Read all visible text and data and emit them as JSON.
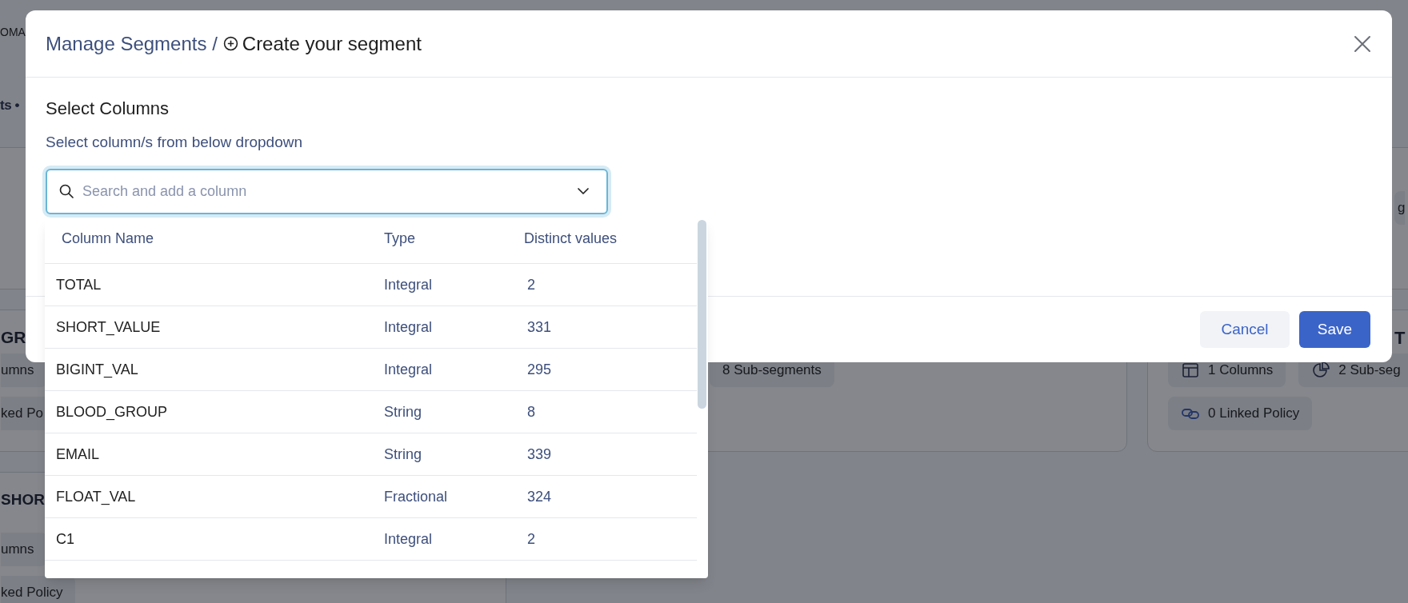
{
  "background": {
    "header_fragment": "OMA",
    "tab_fragment": "ts •",
    "cards": [
      {
        "chips": [
          {
            "kind": "plain",
            "text": "g"
          }
        ]
      },
      {
        "title": "GR",
        "chips": [
          {
            "kind": "plain",
            "text": "umns"
          },
          {
            "kind": "plain",
            "text": "ked Po"
          }
        ]
      },
      {
        "chips": [
          {
            "kind": "plain",
            "text": "8 Sub-segments"
          }
        ]
      },
      {
        "title": "T",
        "chips": [
          {
            "kind": "columns",
            "text": "1 Columns"
          },
          {
            "kind": "subsegments",
            "text": "2 Sub-seg"
          },
          {
            "kind": "policy",
            "text": "0 Linked Policy"
          }
        ]
      },
      {
        "title": "SHOR",
        "chips": [
          {
            "kind": "plain",
            "text": "umns"
          },
          {
            "kind": "plain",
            "text": "ked Policy"
          }
        ]
      }
    ]
  },
  "dialog": {
    "breadcrumb": "Manage Segments /",
    "title": "Create your segment",
    "section_title": "Select Columns",
    "section_subtitle": "Select column/s from below dropdown",
    "search": {
      "placeholder": "Search and add a column"
    },
    "dropdown": {
      "columns": [
        "Column Name",
        "Type",
        "Distinct values"
      ],
      "rows": [
        [
          "TOTAL",
          "Integral",
          "2"
        ],
        [
          "SHORT_VALUE",
          "Integral",
          "331"
        ],
        [
          "BIGINT_VAL",
          "Integral",
          "295"
        ],
        [
          "BLOOD_GROUP",
          "String",
          "8"
        ],
        [
          "EMAIL",
          "String",
          "339"
        ],
        [
          "FLOAT_VAL",
          "Fractional",
          "324"
        ],
        [
          "C1",
          "Integral",
          "2"
        ]
      ]
    },
    "buttons": [
      {
        "kind": "secondary",
        "label": "Cancel"
      },
      {
        "kind": "primary",
        "label": "Save"
      }
    ]
  }
}
